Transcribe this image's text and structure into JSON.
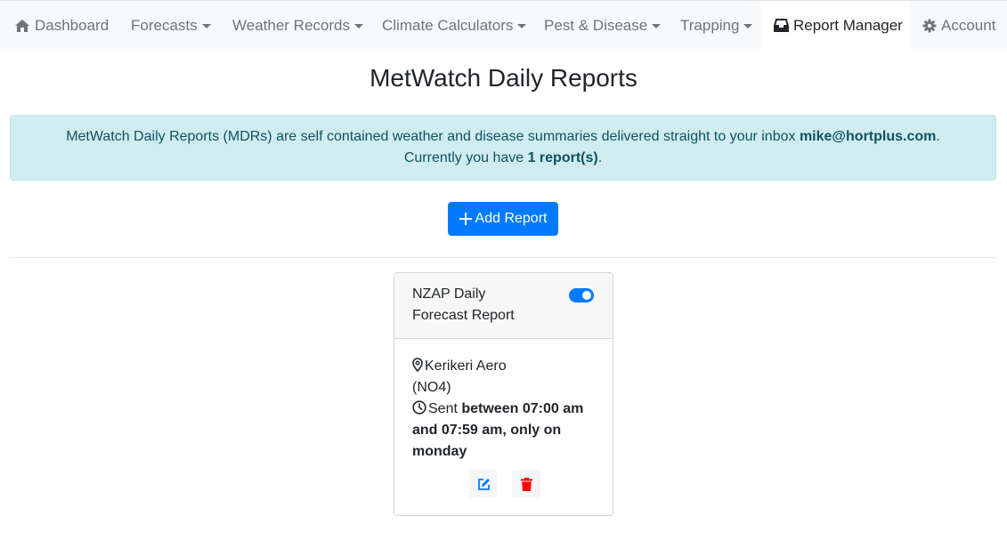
{
  "nav": {
    "dashboard": "Dashboard",
    "forecasts": "Forecasts",
    "weather_records": "Weather Records",
    "climate_calculators": "Climate Calculators",
    "pest_disease": "Pest & Disease",
    "trapping": "Trapping",
    "report_manager": "Report Manager",
    "account": "Account",
    "active": "Report Manager"
  },
  "page": {
    "title": "MetWatch Daily Reports"
  },
  "alert": {
    "text_before": "MetWatch Daily Reports (MDRs) are self contained weather and disease summaries delivered straight to your inbox ",
    "email": "mike@hortplus.com",
    "text_after": ".",
    "count_prefix": "Currently you have ",
    "count": "1 report(s)",
    "count_suffix": "."
  },
  "add_button": {
    "label": "Add Report",
    "icon": "plus-icon"
  },
  "reports": [
    {
      "name": "NZAP Daily Forecast Report",
      "enabled": true,
      "location": "Kerikeri Aero",
      "station_code": "(NO4)",
      "sent_prefix": "Sent ",
      "schedule": "between 07:00 am and 07:59 am, only on monday",
      "edit_icon": "edit-icon",
      "delete_icon": "trash-icon"
    }
  ],
  "colors": {
    "primary": "#007bff",
    "alert_bg": "#d1ecf1",
    "alert_text": "#0c5460",
    "danger": "#ff0000",
    "navbar_bg": "#f8f9fa"
  }
}
